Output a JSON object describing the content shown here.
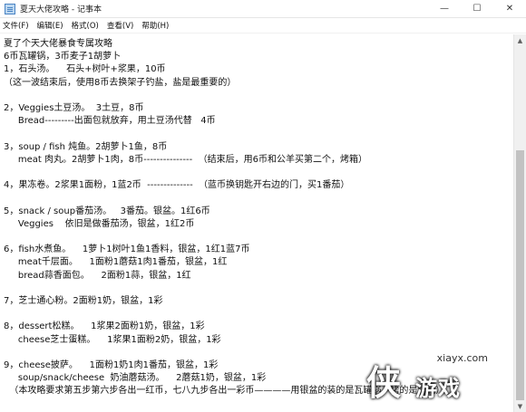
{
  "window": {
    "title": "夏天大佬攻略 - 记事本",
    "minimize": "—",
    "maximize": "☐",
    "close": "✕"
  },
  "menu": [
    "文件(F)",
    "编辑(E)",
    "格式(O)",
    "查看(V)",
    "帮助(H)"
  ],
  "lines": [
    "夏了个天大佬暴食专属攻略",
    "6币瓦罐锅，3币麦子1胡萝卜",
    "1，石头汤。    石头+树叶+浆果，10币",
    "（这一波结束后，使用8币去换架子钓盐，盐是最重要的）",
    "",
    "2，Veggies土豆汤。  3土豆，8币",
    "     Bread---------出面包就放弃，用土豆汤代替   4币",
    "",
    "3，soup / fish 炖鱼。2胡萝卜1鱼，8币",
    "     meat 肉丸。2胡萝卜1肉，8币---------------  （结束后，用6币和公羊买第二个，烤箱）",
    "",
    "4，果冻卷。2浆果1面粉，1蓝2币  --------------  （蓝币换钥匙开右边的门，买1番茄）",
    "",
    "5，snack / soup番茄汤。   3番茄。银盆。1红6币",
    "     Veggies    依旧是做番茄汤，银盆，1红2币",
    "",
    "6，fish水煮鱼。    1萝卜1树叶1鱼1香料，银盆，1红1蓝7币",
    "     meat千层面。    1面粉1蘑菇1肉1番茄，银盆，1红",
    "     bread蒜香面包。    2面粉1蒜，银盆，1红",
    "",
    "7，芝士通心粉。2面粉1奶，银盆，1彩",
    "",
    "8，dessert松糕。    1浆果2面粉1奶，银盆，1彩",
    "     cheese芝士蛋糕。    1浆果1面粉2奶，银盆，1彩",
    "",
    "9，cheese披萨。    1面粉1奶1肉1番茄，银盆，1彩",
    "     soup/snack/cheese  奶油蘑菇汤。    2蘑菇1奶，银盆，1彩",
    "  （本攻略要求第五步第六步各出一红币，七八九步各出一彩币————用银盆的装的是瓦罐锅，烤的是烤箱）"
  ],
  "watermark": {
    "site": "xiayx.com",
    "mark": "侠",
    "name": "游戏"
  }
}
